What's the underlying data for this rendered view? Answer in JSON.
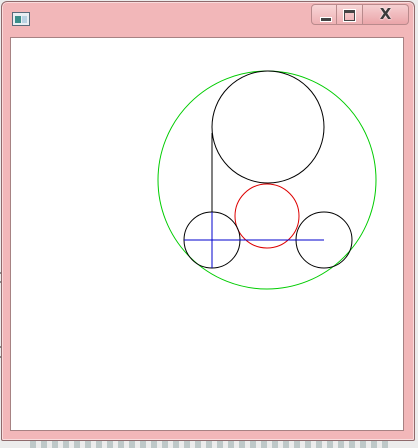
{
  "window": {
    "title": "",
    "controls": {
      "minimize_glyph": "—",
      "maximize_glyph": "□",
      "close_glyph": "X"
    },
    "frame_color": "#f2b7b9"
  },
  "canvas": {
    "background": "#ffffff",
    "colors": {
      "outer_circle": "#00cc00",
      "center_circle": "#dd0000",
      "black_circles": "#000000",
      "axis_lines": "#0000cc"
    }
  }
}
